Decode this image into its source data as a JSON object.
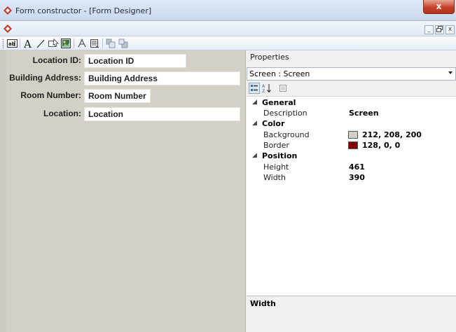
{
  "window": {
    "title": "Form constructor - [Form Designer]",
    "close_label": "x",
    "minimize_label": "_",
    "restore_label": "ï¿½",
    "close_doc_label": "x"
  },
  "toolbar": {
    "tools": [
      "textbox-icon",
      "label-icon",
      "line-icon",
      "button-icon",
      "picture-icon",
      "align-icon",
      "list-icon",
      "bring-front-icon",
      "send-back-icon"
    ]
  },
  "form": {
    "fields": [
      {
        "label": "Location ID:",
        "value": "Location ID"
      },
      {
        "label": "Building Address:",
        "value": "Building Address"
      },
      {
        "label": "Room Number:",
        "value": "Room Number"
      },
      {
        "label": "Location:",
        "value": "Location"
      }
    ]
  },
  "properties": {
    "title": "Properties",
    "selected_object": "Screen : Screen",
    "categories": {
      "general": "General",
      "color": "Color",
      "position": "Position"
    },
    "rows": {
      "description": {
        "name": "Description",
        "value": "Screen"
      },
      "background": {
        "name": "Background",
        "value": "212, 208, 200",
        "color": "#d4d0c8"
      },
      "border": {
        "name": "Border",
        "value": "128, 0, 0",
        "color": "#800000"
      },
      "height": {
        "name": "Height",
        "value": "461"
      },
      "width": {
        "name": "Width",
        "value": "390"
      }
    },
    "description_title": "Width"
  }
}
